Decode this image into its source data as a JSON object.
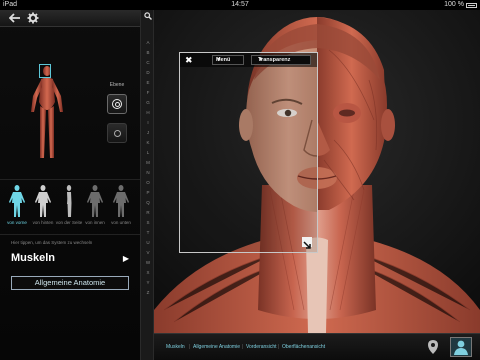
{
  "status": {
    "device": "iPad",
    "time": "14:57",
    "battery": "100 %"
  },
  "panel": {
    "layer_label": "Ebene",
    "views": [
      {
        "label": "von vorne",
        "active": true
      },
      {
        "label": "von hinten",
        "active": false
      },
      {
        "label": "von der Seite",
        "active": false
      },
      {
        "label": "von innen",
        "active": false
      },
      {
        "label": "von unten",
        "active": false
      }
    ],
    "hint": "Hier tippen, um das System zu wechseln",
    "system_title": "Muskeln",
    "button_label": "Allgemeine Anatomie"
  },
  "alphabet": [
    "A",
    "B",
    "C",
    "D",
    "E",
    "F",
    "G",
    "H",
    "I",
    "J",
    "K",
    "L",
    "M",
    "N",
    "O",
    "P",
    "Q",
    "R",
    "S",
    "T",
    "U",
    "V",
    "W",
    "X",
    "Y",
    "Z"
  ],
  "window": {
    "menu_label": "Menü",
    "transparency_label": "Transparenz"
  },
  "breadcrumb": [
    "Muskeln",
    "Allgemeine Anatomie",
    "Vorderansicht",
    "Oberflächenansicht"
  ],
  "colors": {
    "accent": "#6fd6e6",
    "muscle": "#c8654f",
    "skin": "#d9a88c"
  }
}
